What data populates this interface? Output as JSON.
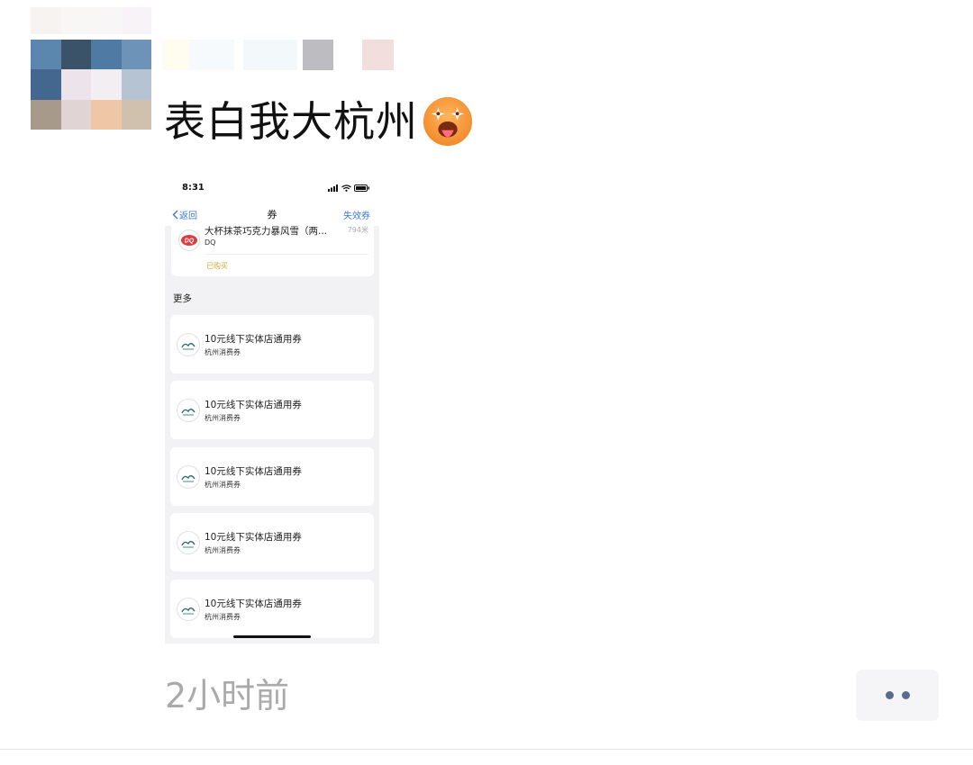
{
  "post": {
    "text": "表白我大杭州",
    "emoji": "star-eyed-tongue-emoji",
    "timestamp": "2小时前"
  },
  "screenshot": {
    "status_time": "8:31",
    "nav": {
      "back_label": "返回",
      "title": "券",
      "right_label": "失效券"
    },
    "top_card": {
      "title": "大杯抹茶巧克力暴风雪（两...",
      "distance": "794米",
      "brand": "DQ",
      "logo_text": "DQ",
      "status": "已购买"
    },
    "section_label": "更多",
    "coupons": [
      {
        "title": "10元线下实体店通用券",
        "subtitle": "杭州消费券"
      },
      {
        "title": "10元线下实体店通用券",
        "subtitle": "杭州消费券"
      },
      {
        "title": "10元线下实体店通用券",
        "subtitle": "杭州消费券"
      },
      {
        "title": "10元线下实体店通用券",
        "subtitle": "杭州消费券"
      },
      {
        "title": "10元线下实体店通用券",
        "subtitle": "杭州消费券"
      }
    ]
  },
  "colors": {
    "link_blue": "#3a7bd5",
    "bought_gold": "#d0a83c",
    "more_dots": "#5a6b8c"
  }
}
